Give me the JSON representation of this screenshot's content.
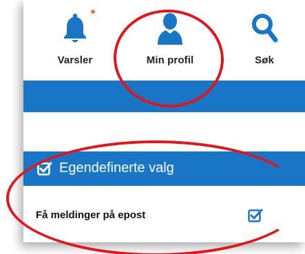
{
  "nav": {
    "items": [
      {
        "label": "Varsler",
        "icon": "bell-icon"
      },
      {
        "label": "Min profil",
        "icon": "user-icon"
      },
      {
        "label": "Søk",
        "icon": "search-icon"
      }
    ]
  },
  "section": {
    "title": "Egendefinerte valg",
    "icon": "checkbox-checked-icon"
  },
  "options": [
    {
      "label": "Få meldinger på epost",
      "checked": true
    }
  ],
  "colors": {
    "brand_blue": "#1976c7",
    "annotation_red": "#e3151a",
    "notification_dot": "#f07a2b"
  }
}
